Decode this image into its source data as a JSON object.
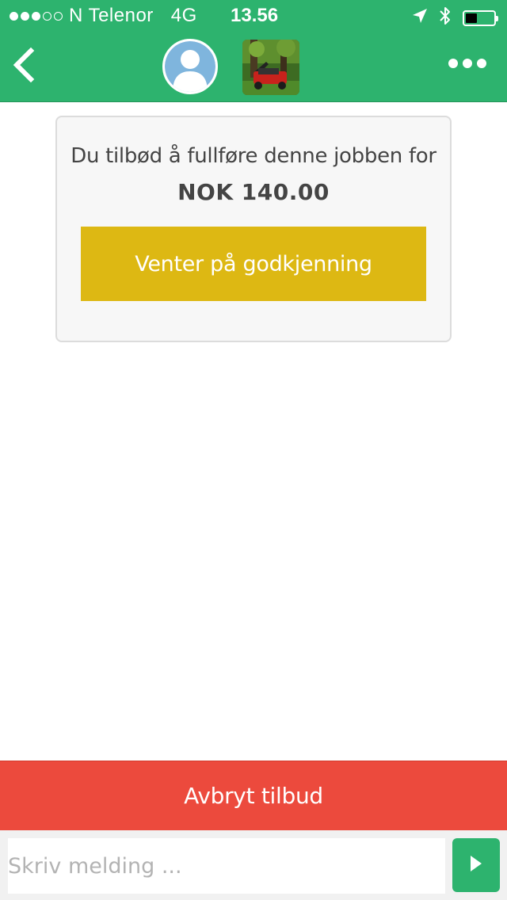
{
  "status_bar": {
    "carrier": "N Telenor",
    "network": "4G",
    "time": "13.56",
    "signal_strength": 3,
    "signal_max": 5,
    "battery_level": 0.4,
    "icons": [
      "location-arrow-icon",
      "bluetooth-icon",
      "battery-icon"
    ]
  },
  "nav": {
    "back_icon": "chevron-left-icon",
    "avatar_icon": "user-avatar-placeholder-icon",
    "job_image": "lawn-mower-photo",
    "more_icon": "ellipsis-icon"
  },
  "offer": {
    "text": "Du tilbød å fullføre denne jobben for",
    "price": "NOK 140.00",
    "status_label": "Venter på godkjenning"
  },
  "cancel_button": {
    "label": "Avbryt tilbud"
  },
  "composer": {
    "placeholder": "Skriv melding ...",
    "value": "",
    "send_icon": "play-triangle-icon"
  },
  "colors": {
    "brand_green": "#2db36e",
    "pending_yellow": "#ddb813",
    "cancel_red": "#ec4a3d"
  }
}
